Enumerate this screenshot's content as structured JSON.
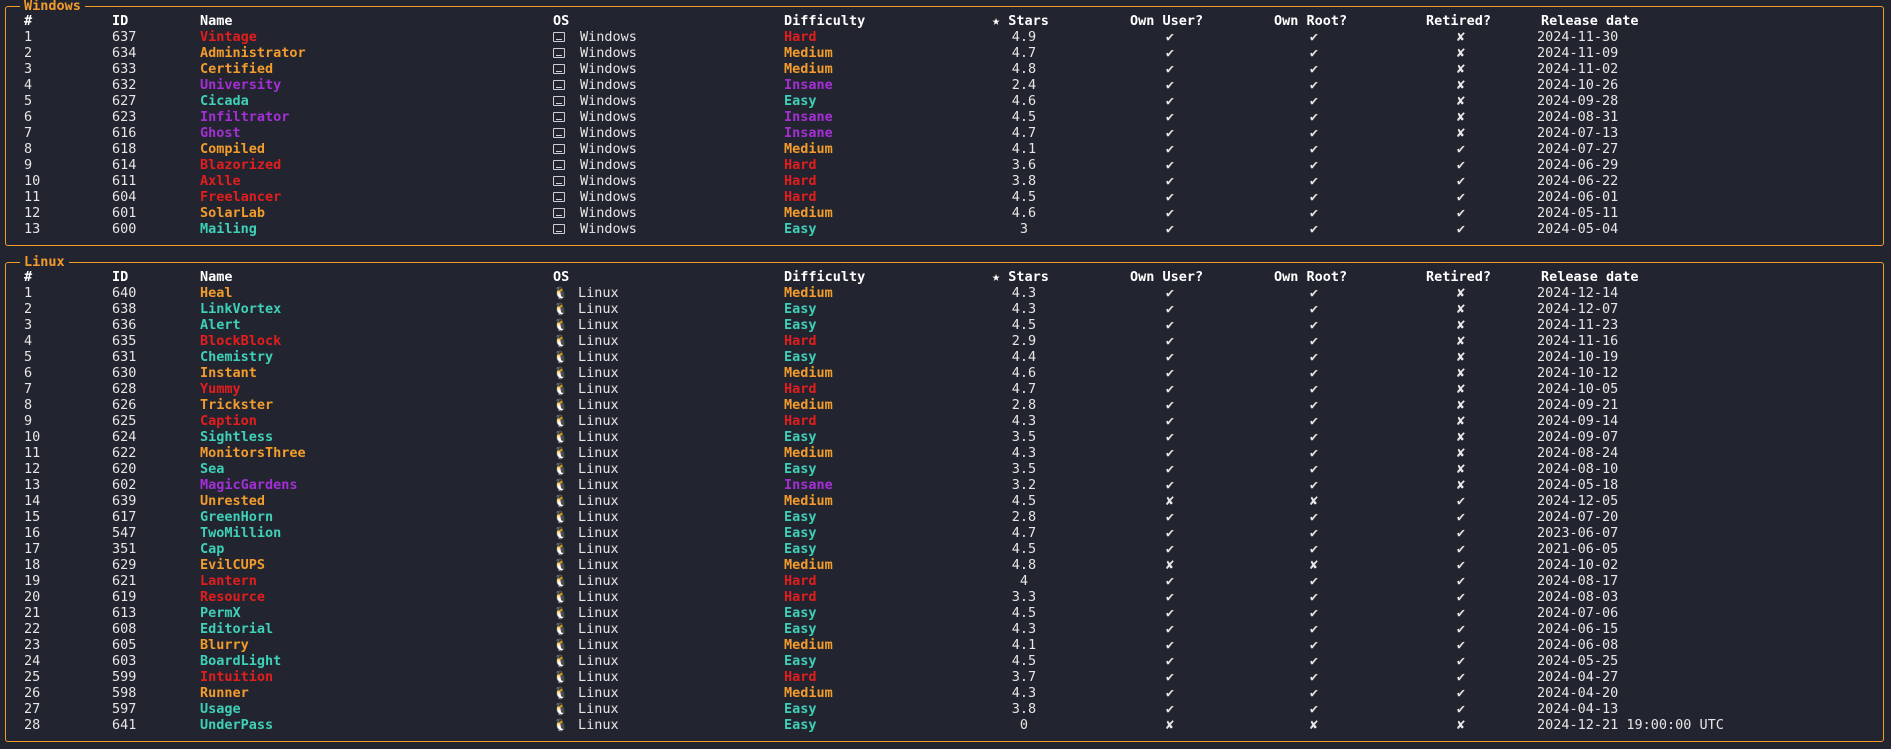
{
  "colors": {
    "accent": "#f39c2b",
    "easy": "#3fd1b8",
    "medium": "#f39c2b",
    "hard": "#e51d1d",
    "insane": "#a52fd6",
    "background": "#22252f"
  },
  "headers": {
    "num": "#",
    "id": "ID",
    "name": "Name",
    "os": "OS",
    "difficulty": "Difficulty",
    "stars": "★ Stars",
    "own_user": "Own User?",
    "own_root": "Own Root?",
    "retired": "Retired?",
    "release_date": "Release date"
  },
  "windows": {
    "title": "Windows",
    "rows": [
      {
        "num": "1",
        "id": "637",
        "name": "Vintage",
        "os_icon": "window-icon",
        "os": "Windows",
        "difficulty": "Hard",
        "stars": "4.9",
        "own_user": "✔",
        "own_root": "✔",
        "retired": "✘",
        "date": "2024-11-30"
      },
      {
        "num": "2",
        "id": "634",
        "name": "Administrator",
        "os_icon": "window-icon",
        "os": "Windows",
        "difficulty": "Medium",
        "stars": "4.7",
        "own_user": "✔",
        "own_root": "✔",
        "retired": "✘",
        "date": "2024-11-09"
      },
      {
        "num": "3",
        "id": "633",
        "name": "Certified",
        "os_icon": "window-icon",
        "os": "Windows",
        "difficulty": "Medium",
        "stars": "4.8",
        "own_user": "✔",
        "own_root": "✔",
        "retired": "✘",
        "date": "2024-11-02"
      },
      {
        "num": "4",
        "id": "632",
        "name": "University",
        "os_icon": "window-icon",
        "os": "Windows",
        "difficulty": "Insane",
        "stars": "2.4",
        "own_user": "✔",
        "own_root": "✔",
        "retired": "✘",
        "date": "2024-10-26"
      },
      {
        "num": "5",
        "id": "627",
        "name": "Cicada",
        "os_icon": "window-icon",
        "os": "Windows",
        "difficulty": "Easy",
        "stars": "4.6",
        "own_user": "✔",
        "own_root": "✔",
        "retired": "✘",
        "date": "2024-09-28"
      },
      {
        "num": "6",
        "id": "623",
        "name": "Infiltrator",
        "os_icon": "window-icon",
        "os": "Windows",
        "difficulty": "Insane",
        "stars": "4.5",
        "own_user": "✔",
        "own_root": "✔",
        "retired": "✘",
        "date": "2024-08-31"
      },
      {
        "num": "7",
        "id": "616",
        "name": "Ghost",
        "os_icon": "window-icon",
        "os": "Windows",
        "difficulty": "Insane",
        "stars": "4.7",
        "own_user": "✔",
        "own_root": "✔",
        "retired": "✘",
        "date": "2024-07-13"
      },
      {
        "num": "8",
        "id": "618",
        "name": "Compiled",
        "os_icon": "window-icon",
        "os": "Windows",
        "difficulty": "Medium",
        "stars": "4.1",
        "own_user": "✔",
        "own_root": "✔",
        "retired": "✔",
        "date": "2024-07-27"
      },
      {
        "num": "9",
        "id": "614",
        "name": "Blazorized",
        "os_icon": "window-icon",
        "os": "Windows",
        "difficulty": "Hard",
        "stars": "3.6",
        "own_user": "✔",
        "own_root": "✔",
        "retired": "✔",
        "date": "2024-06-29"
      },
      {
        "num": "10",
        "id": "611",
        "name": "Axlle",
        "os_icon": "window-icon",
        "os": "Windows",
        "difficulty": "Hard",
        "stars": "3.8",
        "own_user": "✔",
        "own_root": "✔",
        "retired": "✔",
        "date": "2024-06-22"
      },
      {
        "num": "11",
        "id": "604",
        "name": "Freelancer",
        "os_icon": "window-icon",
        "os": "Windows",
        "difficulty": "Hard",
        "stars": "4.5",
        "own_user": "✔",
        "own_root": "✔",
        "retired": "✔",
        "date": "2024-06-01"
      },
      {
        "num": "12",
        "id": "601",
        "name": "SolarLab",
        "os_icon": "window-icon",
        "os": "Windows",
        "difficulty": "Medium",
        "stars": "4.6",
        "own_user": "✔",
        "own_root": "✔",
        "retired": "✔",
        "date": "2024-05-11"
      },
      {
        "num": "13",
        "id": "600",
        "name": "Mailing",
        "os_icon": "window-icon",
        "os": "Windows",
        "difficulty": "Easy",
        "stars": "3",
        "own_user": "✔",
        "own_root": "✔",
        "retired": "✔",
        "date": "2024-05-04"
      }
    ]
  },
  "linux": {
    "title": "Linux",
    "rows": [
      {
        "num": "1",
        "id": "640",
        "name": "Heal",
        "os_icon": "penguin-icon",
        "os": "Linux",
        "difficulty": "Medium",
        "stars": "4.3",
        "own_user": "✔",
        "own_root": "✔",
        "retired": "✘",
        "date": "2024-12-14"
      },
      {
        "num": "2",
        "id": "638",
        "name": "LinkVortex",
        "os_icon": "penguin-icon",
        "os": "Linux",
        "difficulty": "Easy",
        "stars": "4.3",
        "own_user": "✔",
        "own_root": "✔",
        "retired": "✘",
        "date": "2024-12-07"
      },
      {
        "num": "3",
        "id": "636",
        "name": "Alert",
        "os_icon": "penguin-icon",
        "os": "Linux",
        "difficulty": "Easy",
        "stars": "4.5",
        "own_user": "✔",
        "own_root": "✔",
        "retired": "✘",
        "date": "2024-11-23"
      },
      {
        "num": "4",
        "id": "635",
        "name": "BlockBlock",
        "os_icon": "penguin-icon",
        "os": "Linux",
        "difficulty": "Hard",
        "stars": "2.9",
        "own_user": "✔",
        "own_root": "✔",
        "retired": "✘",
        "date": "2024-11-16"
      },
      {
        "num": "5",
        "id": "631",
        "name": "Chemistry",
        "os_icon": "penguin-icon",
        "os": "Linux",
        "difficulty": "Easy",
        "stars": "4.4",
        "own_user": "✔",
        "own_root": "✔",
        "retired": "✘",
        "date": "2024-10-19"
      },
      {
        "num": "6",
        "id": "630",
        "name": "Instant",
        "os_icon": "penguin-icon",
        "os": "Linux",
        "difficulty": "Medium",
        "stars": "4.6",
        "own_user": "✔",
        "own_root": "✔",
        "retired": "✘",
        "date": "2024-10-12"
      },
      {
        "num": "7",
        "id": "628",
        "name": "Yummy",
        "os_icon": "penguin-icon",
        "os": "Linux",
        "difficulty": "Hard",
        "stars": "4.7",
        "own_user": "✔",
        "own_root": "✔",
        "retired": "✘",
        "date": "2024-10-05"
      },
      {
        "num": "8",
        "id": "626",
        "name": "Trickster",
        "os_icon": "penguin-icon",
        "os": "Linux",
        "difficulty": "Medium",
        "stars": "2.8",
        "own_user": "✔",
        "own_root": "✔",
        "retired": "✘",
        "date": "2024-09-21"
      },
      {
        "num": "9",
        "id": "625",
        "name": "Caption",
        "os_icon": "penguin-icon",
        "os": "Linux",
        "difficulty": "Hard",
        "stars": "4.3",
        "own_user": "✔",
        "own_root": "✔",
        "retired": "✘",
        "date": "2024-09-14"
      },
      {
        "num": "10",
        "id": "624",
        "name": "Sightless",
        "os_icon": "penguin-icon",
        "os": "Linux",
        "difficulty": "Easy",
        "stars": "3.5",
        "own_user": "✔",
        "own_root": "✔",
        "retired": "✘",
        "date": "2024-09-07"
      },
      {
        "num": "11",
        "id": "622",
        "name": "MonitorsThree",
        "os_icon": "penguin-icon",
        "os": "Linux",
        "difficulty": "Medium",
        "stars": "4.3",
        "own_user": "✔",
        "own_root": "✔",
        "retired": "✘",
        "date": "2024-08-24"
      },
      {
        "num": "12",
        "id": "620",
        "name": "Sea",
        "os_icon": "penguin-icon",
        "os": "Linux",
        "difficulty": "Easy",
        "stars": "3.5",
        "own_user": "✔",
        "own_root": "✔",
        "retired": "✘",
        "date": "2024-08-10"
      },
      {
        "num": "13",
        "id": "602",
        "name": "MagicGardens",
        "os_icon": "penguin-icon",
        "os": "Linux",
        "difficulty": "Insane",
        "stars": "3.2",
        "own_user": "✔",
        "own_root": "✔",
        "retired": "✘",
        "date": "2024-05-18"
      },
      {
        "num": "14",
        "id": "639",
        "name": "Unrested",
        "os_icon": "penguin-icon",
        "os": "Linux",
        "difficulty": "Medium",
        "stars": "4.5",
        "own_user": "✘",
        "own_root": "✘",
        "retired": "✔",
        "date": "2024-12-05"
      },
      {
        "num": "15",
        "id": "617",
        "name": "GreenHorn",
        "os_icon": "penguin-icon",
        "os": "Linux",
        "difficulty": "Easy",
        "stars": "2.8",
        "own_user": "✔",
        "own_root": "✔",
        "retired": "✔",
        "date": "2024-07-20"
      },
      {
        "num": "16",
        "id": "547",
        "name": "TwoMillion",
        "os_icon": "penguin-icon",
        "os": "Linux",
        "difficulty": "Easy",
        "stars": "4.7",
        "own_user": "✔",
        "own_root": "✔",
        "retired": "✔",
        "date": "2023-06-07"
      },
      {
        "num": "17",
        "id": "351",
        "name": "Cap",
        "os_icon": "penguin-icon",
        "os": "Linux",
        "difficulty": "Easy",
        "stars": "4.5",
        "own_user": "✔",
        "own_root": "✔",
        "retired": "✔",
        "date": "2021-06-05"
      },
      {
        "num": "18",
        "id": "629",
        "name": "EvilCUPS",
        "os_icon": "penguin-icon",
        "os": "Linux",
        "difficulty": "Medium",
        "stars": "4.8",
        "own_user": "✘",
        "own_root": "✘",
        "retired": "✔",
        "date": "2024-10-02"
      },
      {
        "num": "19",
        "id": "621",
        "name": "Lantern",
        "os_icon": "penguin-icon",
        "os": "Linux",
        "difficulty": "Hard",
        "stars": "4",
        "own_user": "✔",
        "own_root": "✔",
        "retired": "✔",
        "date": "2024-08-17"
      },
      {
        "num": "20",
        "id": "619",
        "name": "Resource",
        "os_icon": "penguin-icon",
        "os": "Linux",
        "difficulty": "Hard",
        "stars": "3.3",
        "own_user": "✔",
        "own_root": "✔",
        "retired": "✔",
        "date": "2024-08-03"
      },
      {
        "num": "21",
        "id": "613",
        "name": "PermX",
        "os_icon": "penguin-icon",
        "os": "Linux",
        "difficulty": "Easy",
        "stars": "4.5",
        "own_user": "✔",
        "own_root": "✔",
        "retired": "✔",
        "date": "2024-07-06"
      },
      {
        "num": "22",
        "id": "608",
        "name": "Editorial",
        "os_icon": "penguin-icon",
        "os": "Linux",
        "difficulty": "Easy",
        "stars": "4.3",
        "own_user": "✔",
        "own_root": "✔",
        "retired": "✔",
        "date": "2024-06-15"
      },
      {
        "num": "23",
        "id": "605",
        "name": "Blurry",
        "os_icon": "penguin-icon",
        "os": "Linux",
        "difficulty": "Medium",
        "stars": "4.1",
        "own_user": "✔",
        "own_root": "✔",
        "retired": "✔",
        "date": "2024-06-08"
      },
      {
        "num": "24",
        "id": "603",
        "name": "BoardLight",
        "os_icon": "penguin-icon",
        "os": "Linux",
        "difficulty": "Easy",
        "stars": "4.5",
        "own_user": "✔",
        "own_root": "✔",
        "retired": "✔",
        "date": "2024-05-25"
      },
      {
        "num": "25",
        "id": "599",
        "name": "Intuition",
        "os_icon": "penguin-icon",
        "os": "Linux",
        "difficulty": "Hard",
        "stars": "3.7",
        "own_user": "✔",
        "own_root": "✔",
        "retired": "✔",
        "date": "2024-04-27"
      },
      {
        "num": "26",
        "id": "598",
        "name": "Runner",
        "os_icon": "penguin-icon",
        "os": "Linux",
        "difficulty": "Medium",
        "stars": "4.3",
        "own_user": "✔",
        "own_root": "✔",
        "retired": "✔",
        "date": "2024-04-20"
      },
      {
        "num": "27",
        "id": "597",
        "name": "Usage",
        "os_icon": "penguin-icon",
        "os": "Linux",
        "difficulty": "Easy",
        "stars": "3.8",
        "own_user": "✔",
        "own_root": "✔",
        "retired": "✔",
        "date": "2024-04-13"
      },
      {
        "num": "28",
        "id": "641",
        "name": "UnderPass",
        "os_icon": "penguin-icon",
        "os": "Linux",
        "difficulty": "Easy",
        "stars": "0",
        "own_user": "✘",
        "own_root": "✘",
        "retired": "✘",
        "date": "2024-12-21 19:00:00 UTC"
      }
    ]
  }
}
